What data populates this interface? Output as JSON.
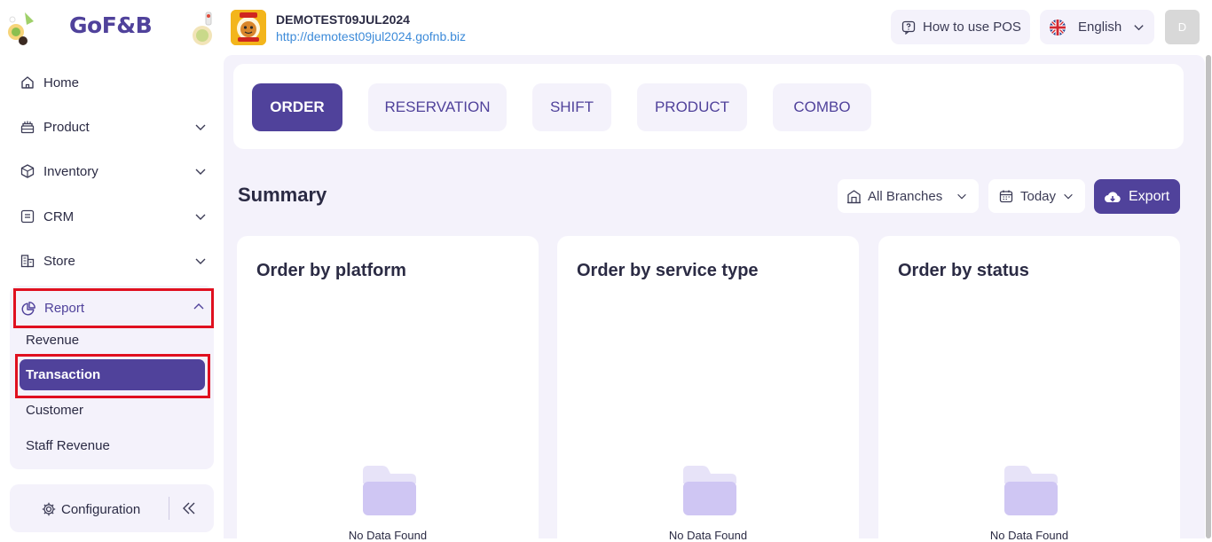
{
  "brand": {
    "logo_text": "GoF&B"
  },
  "sidebar": {
    "items": [
      {
        "label": "Home",
        "icon": "home-icon"
      },
      {
        "label": "Product",
        "icon": "product-icon"
      },
      {
        "label": "Inventory",
        "icon": "box-icon"
      },
      {
        "label": "CRM",
        "icon": "crm-icon"
      },
      {
        "label": "Store",
        "icon": "store-icon"
      }
    ],
    "report": {
      "label": "Report",
      "icon": "pie-chart-icon",
      "expanded": true,
      "subitems": [
        "Revenue",
        "Transaction",
        "Customer",
        "Staff Revenue"
      ],
      "active_subitem": "Transaction"
    },
    "config_label": "Configuration"
  },
  "store": {
    "name": "DEMOTEST09JUL2024",
    "url": "http://demotest09jul2024.gofnb.biz"
  },
  "header": {
    "howto_label": "How to use POS",
    "language": "English",
    "avatar_initial": "D"
  },
  "tabs": {
    "items": [
      "ORDER",
      "RESERVATION",
      "SHIFT",
      "PRODUCT",
      "COMBO"
    ],
    "active": "ORDER"
  },
  "summary": {
    "title": "Summary",
    "branch_filter": "All Branches",
    "date_filter": "Today",
    "export_label": "Export"
  },
  "cards": [
    {
      "title": "Order by platform",
      "empty_text": "No Data Found"
    },
    {
      "title": "Order by service type",
      "empty_text": "No Data Found"
    },
    {
      "title": "Order by status",
      "empty_text": "No Data Found"
    }
  ],
  "colors": {
    "primary": "#50429b",
    "panel_bg": "#f4f2fb",
    "highlight_border": "#e0101f",
    "link": "#3d8bd9"
  }
}
